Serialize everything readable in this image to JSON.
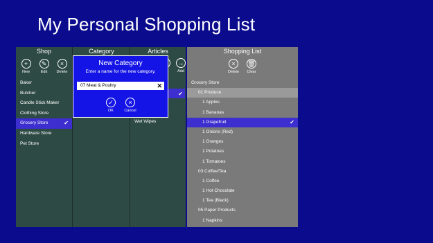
{
  "app": {
    "title": "My Personal Shopping List"
  },
  "shop": {
    "header": "Shop",
    "buttons": {
      "new": "New",
      "edit": "Edit",
      "delete": "Delete"
    },
    "items": [
      "Baker",
      "Butcher",
      "Candle Stick Maker",
      "Clothing Store",
      "Grocery Store",
      "Hardware Store",
      "Pet Store"
    ],
    "selected": "Grocery Store"
  },
  "category": {
    "header": "Category"
  },
  "articles": {
    "header": "Articles",
    "add_label": "Add",
    "visible_item": "Wet Wipes"
  },
  "shopping_list": {
    "header": "Shopping List",
    "buttons": {
      "delete": "Delete",
      "clear": "Clear"
    },
    "rows": [
      {
        "text": "Grocery Store",
        "kind": "store"
      },
      {
        "text": "01 Produce",
        "kind": "category"
      },
      {
        "text": "1  Apples",
        "kind": "item"
      },
      {
        "text": "1  Bananas",
        "kind": "item"
      },
      {
        "text": "1  Grapefruit",
        "kind": "item-selected"
      },
      {
        "text": "1  Onions (Red)",
        "kind": "item"
      },
      {
        "text": "1  Oranges",
        "kind": "item"
      },
      {
        "text": "1  Potatoes",
        "kind": "item"
      },
      {
        "text": "1  Tomatoes",
        "kind": "item"
      },
      {
        "text": "03 Coffee/Tea",
        "kind": "category-plain"
      },
      {
        "text": "1  Coffee",
        "kind": "item"
      },
      {
        "text": "1  Hot Chocolate",
        "kind": "item"
      },
      {
        "text": "1  Tea (Black)",
        "kind": "item"
      },
      {
        "text": "05 Paper Products",
        "kind": "category-plain"
      },
      {
        "text": "1  Napkins",
        "kind": "item"
      }
    ]
  },
  "dialog": {
    "title": "New Category",
    "prompt": "Enter a name for the new category.",
    "input_value": "07 Meat & Poultry",
    "ok_label": "OK",
    "cancel_label": "Cancel"
  },
  "icons": {
    "new": "plus-circle-icon",
    "edit": "pencil-circle-icon",
    "delete": "x-circle-icon",
    "add": "arrow-right-circle-icon",
    "clear": "trash-circle-icon",
    "check": "checkmark-icon"
  },
  "colors": {
    "background": "#0b0b8e",
    "panel": "#2e4a44",
    "list_panel": "#7a7a7a",
    "selection": "#3d2ecf",
    "dialog": "#1414e6"
  }
}
